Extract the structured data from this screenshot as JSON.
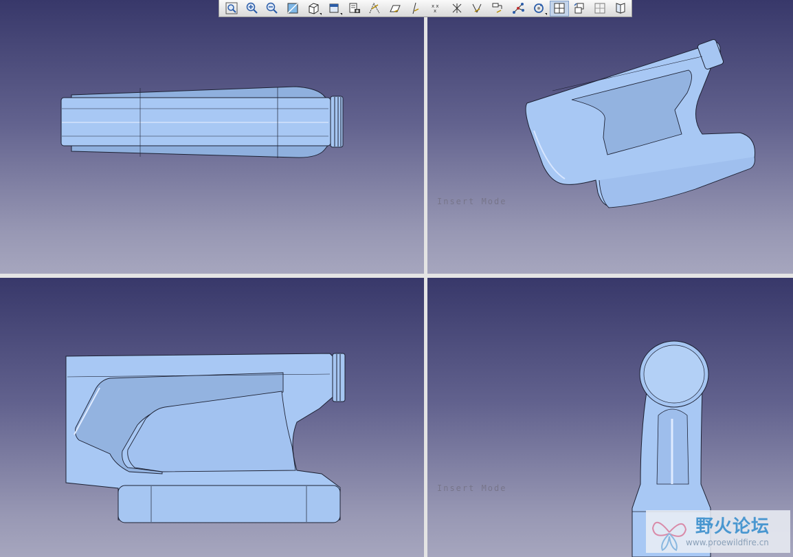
{
  "toolbar": {
    "buttons": [
      {
        "name": "zoom-fit-icon"
      },
      {
        "name": "zoom-in-icon"
      },
      {
        "name": "zoom-out-icon"
      },
      {
        "name": "normal-view-icon"
      },
      {
        "name": "quick-view-cube-icon",
        "dropdown": true
      },
      {
        "name": "shading-mode-icon",
        "dropdown": true
      },
      {
        "name": "capture-icon"
      },
      {
        "name": "hide-show-icon"
      },
      {
        "name": "swap-visible-space-icon"
      },
      {
        "name": "plane-toggle-icon"
      },
      {
        "name": "point-toggle-icon"
      },
      {
        "name": "axis-toggle-icon"
      },
      {
        "name": "csys-toggle-icon"
      },
      {
        "name": "annotation-toggle-icon"
      },
      {
        "name": "spin-center-icon"
      },
      {
        "name": "rotate-view-icon",
        "dropdown": true
      },
      {
        "name": "multi-view-icon",
        "active": true
      },
      {
        "name": "tile-views-icon"
      },
      {
        "name": "single-view-icon"
      },
      {
        "name": "book-view-icon"
      }
    ]
  },
  "viewports": {
    "top_right": {
      "mode_text": "Insert Mode"
    },
    "bottom_right": {
      "mode_text": "Insert Mode"
    }
  },
  "watermark": {
    "title": "野火论坛",
    "url": "www.proewildfire.cn"
  },
  "colors": {
    "background_top": "#38386a",
    "background_bottom": "#a6a6be",
    "model_fill": "#a6c6f2",
    "model_edge": "#1c2032",
    "watermark_text": "#4a97d0"
  }
}
